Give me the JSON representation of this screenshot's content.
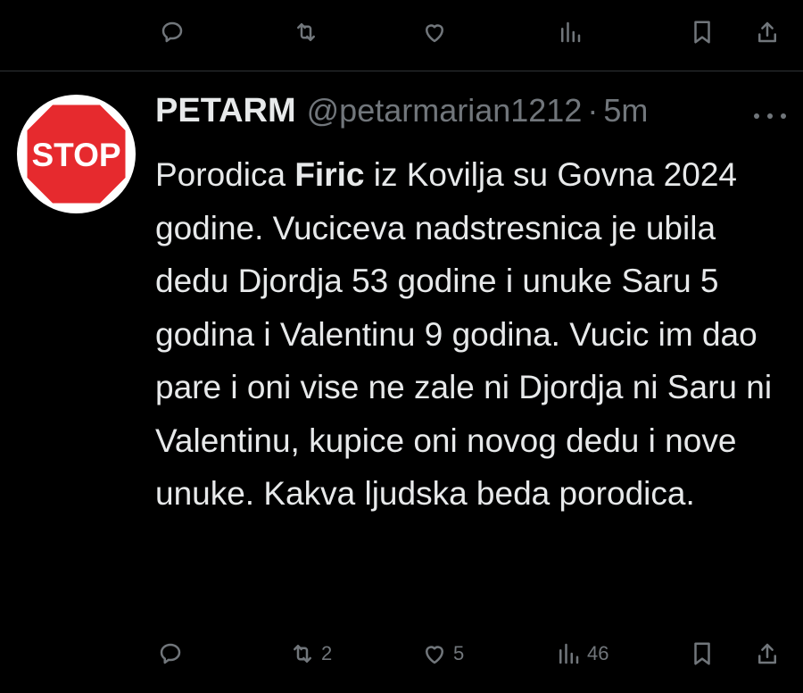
{
  "previous_tweet": {
    "actions": {
      "reply": {
        "icon": "reply-icon",
        "count": ""
      },
      "retweet": {
        "icon": "retweet-icon",
        "count": ""
      },
      "like": {
        "icon": "heart-icon",
        "count": ""
      },
      "views": {
        "icon": "views-icon",
        "count": ""
      },
      "bookmark": {
        "icon": "bookmark-icon"
      },
      "share": {
        "icon": "share-icon"
      }
    }
  },
  "tweet": {
    "author": {
      "display_name": "PETARM",
      "handle": "@petarmarian1212",
      "avatar_text": "STOP",
      "avatar_color": "#e62a2e"
    },
    "separator": "·",
    "time": "5m",
    "text": {
      "part1": "Porodica ",
      "bold": "Firic",
      "part2": " iz Kovilja su Govna 2024 godine. Vuciceva nadstresnica je ubila dedu Djordja 53 godine i unuke Saru 5 godina i Valentinu 9 godina. Vucic im dao pare i oni vise ne zale ni Djordja ni Saru ni Valentinu, kupice oni novog dedu i nove unuke. Kakva ljudska beda porodica."
    },
    "actions": {
      "reply": {
        "icon": "reply-icon",
        "count": ""
      },
      "retweet": {
        "icon": "retweet-icon",
        "count": "2"
      },
      "like": {
        "icon": "heart-icon",
        "count": "5"
      },
      "views": {
        "icon": "views-icon",
        "count": "46"
      },
      "bookmark": {
        "icon": "bookmark-icon"
      },
      "share": {
        "icon": "share-icon"
      }
    }
  },
  "colors": {
    "background": "#000000",
    "text": "#e7e9ea",
    "secondary_text": "#71767b",
    "divider": "#2f3336"
  }
}
